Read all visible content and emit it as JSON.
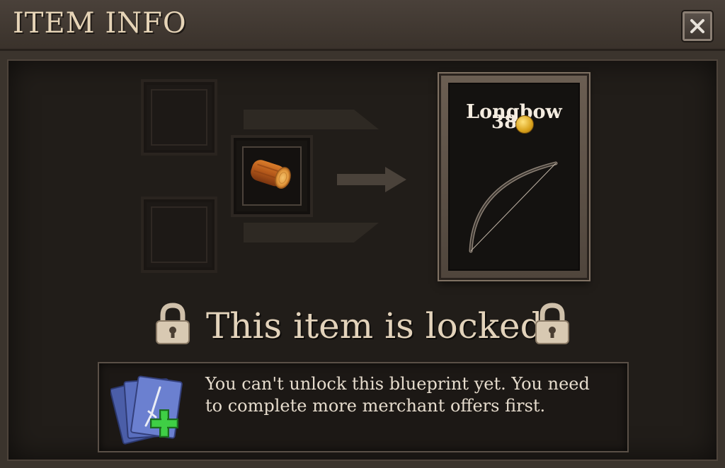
{
  "window": {
    "title": "ITEM INFO"
  },
  "recipe": {
    "ingredients": [
      {
        "slot": "top-left",
        "state": "empty"
      },
      {
        "slot": "middle",
        "state": "filled",
        "item_icon": "log-icon"
      },
      {
        "slot": "bottom-left",
        "state": "empty"
      }
    ]
  },
  "result": {
    "name": "Longbow",
    "price": "38",
    "currency_icon": "gold-coin-icon",
    "item_icon": "longbow-icon"
  },
  "status": {
    "heading": "This item is locked",
    "message": "You can't unlock this blueprint yet. You need to complete more merchant offers first."
  },
  "colors": {
    "background": "#3b342d",
    "inner_panel": "#211d19",
    "title_text": "#e6d4b7",
    "accent_green": "#34b43a",
    "coin_gold": "#d9a21c"
  }
}
